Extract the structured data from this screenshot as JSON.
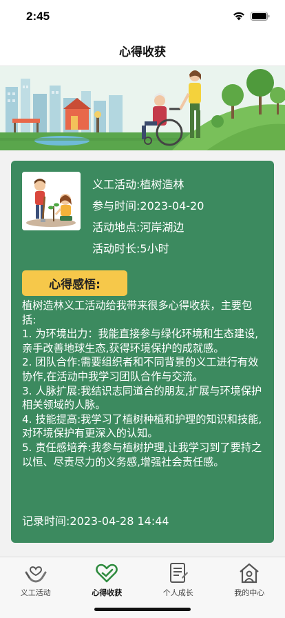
{
  "status_bar": {
    "time": "2:45"
  },
  "nav": {
    "title": "心得收获"
  },
  "activity": {
    "name_line": "义工活动:植树造林",
    "time_line": "参与时间:2023-04-20",
    "place_line": "活动地点:河岸湖边",
    "duration_line": "活动时长:5小时"
  },
  "reflection": {
    "badge": "心得感悟:",
    "text": "植树造林义工活动给我带来很多心得收获，主要包括:\n1. 为环境出力：我能直接参与绿化环境和生态建设,亲手改善地球生态,获得环境保护的成就感。\n2. 团队合作:需要组织者和不同背景的义工进行有效协作,在活动中我学习团队合作与交流。\n3. 人脉扩展:我结识志同道合的朋友,扩展与环境保护相关领域的人脉。\n4. 技能提高:我学习了植树种植和护理的知识和技能,对环境保护有更深入的认知。\n5. 责任感培养:我参与植树护理,让我学习到了要持之以恒、尽责尽力的义务感,增强社会责任感。",
    "record_time": "记录时间:2023-04-28 14:44"
  },
  "tabs": [
    {
      "label": "义工活动",
      "icon": "hands-heart-icon",
      "active": false
    },
    {
      "label": "心得收获",
      "icon": "heart-check-icon",
      "active": true
    },
    {
      "label": "个人成长",
      "icon": "document-icon",
      "active": false
    },
    {
      "label": "我的中心",
      "icon": "home-person-icon",
      "active": false
    }
  ],
  "colors": {
    "card": "#3c8a5f",
    "badge": "#f6c84a",
    "active_tab": "#2e8b3e"
  }
}
